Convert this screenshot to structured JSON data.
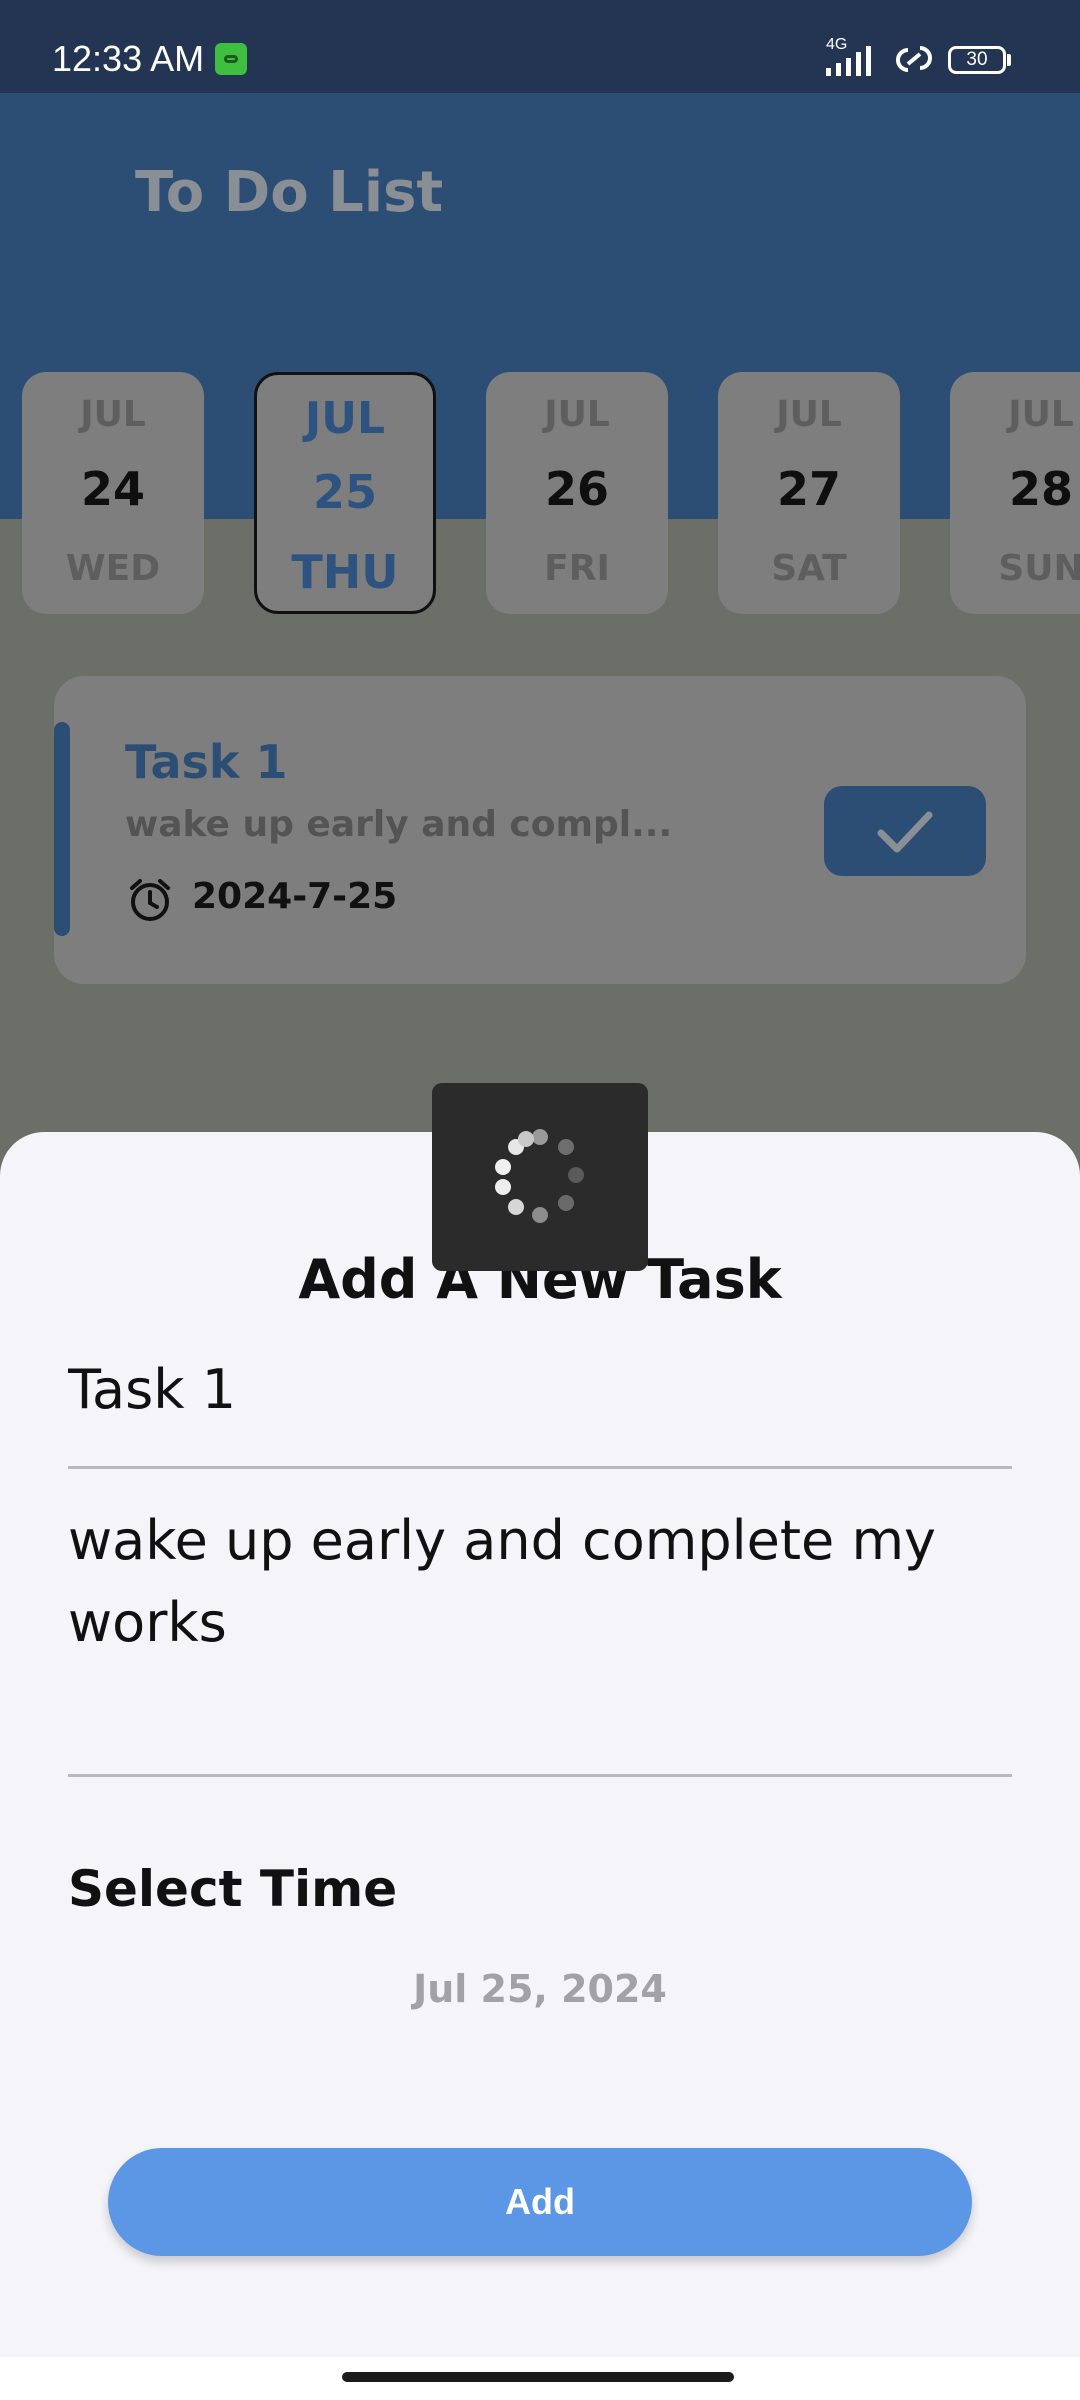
{
  "status_bar": {
    "time": "12:33 AM",
    "network": "4G",
    "battery": "30",
    "icons": [
      "app-notification-icon",
      "signal-icon",
      "link-icon",
      "battery-icon"
    ]
  },
  "app": {
    "title": "To Do List",
    "days": [
      {
        "month": "JUL",
        "date": "24",
        "weekday": "WED",
        "selected": false
      },
      {
        "month": "JUL",
        "date": "25",
        "weekday": "THU",
        "selected": true
      },
      {
        "month": "JUL",
        "date": "26",
        "weekday": "FRI",
        "selected": false
      },
      {
        "month": "JUL",
        "date": "27",
        "weekday": "SAT",
        "selected": false
      },
      {
        "month": "JUL",
        "date": "28",
        "weekday": "SUN",
        "selected": false
      }
    ],
    "task": {
      "title": "Task 1",
      "description": "wake up early and compl...",
      "date": "2024-7-25",
      "icons": [
        "alarm-clock-icon",
        "checkmark-icon"
      ]
    }
  },
  "sheet": {
    "heading": "Add A New Task",
    "title_value": "Task 1",
    "description_value": "wake up early and complete my works",
    "select_time_label": "Select Time",
    "date_value": "Jul 25, 2024",
    "add_label": "Add"
  },
  "loader": {
    "icon": "loading-spinner-icon"
  },
  "colors": {
    "header": "#2d4e74",
    "status_bar": "#233553",
    "accent_button": "#5c97e6",
    "sheet_bg": "#f5f4f9"
  }
}
